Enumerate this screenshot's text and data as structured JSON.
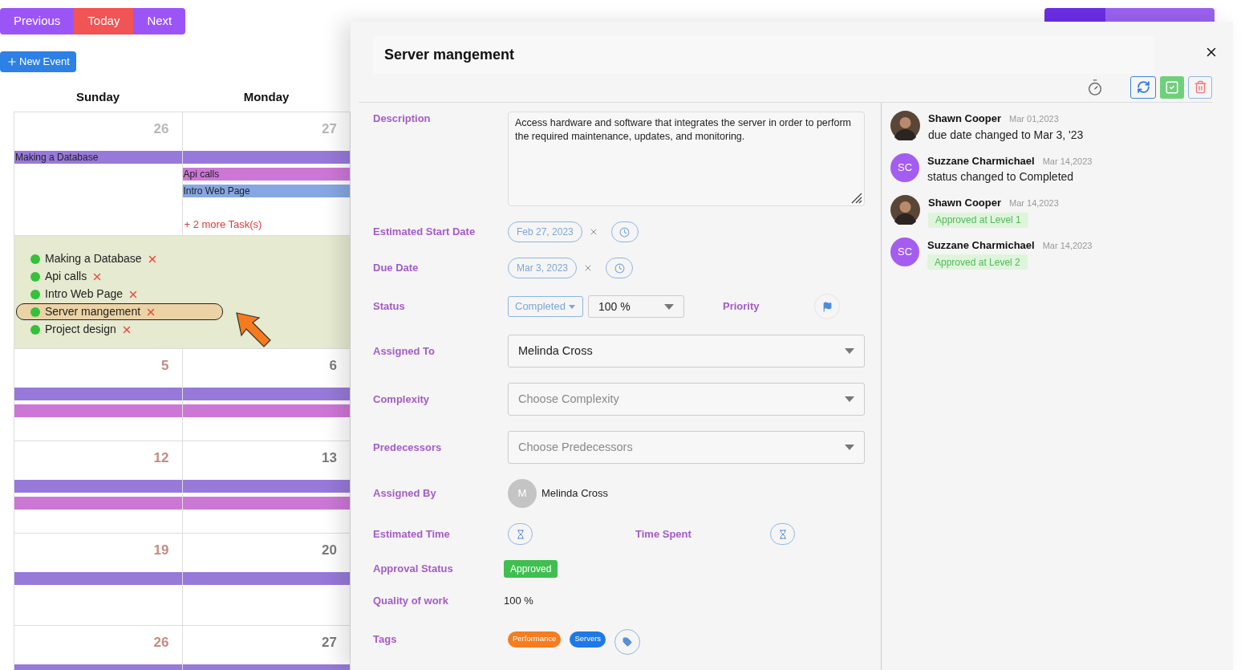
{
  "nav_buttons": [
    {
      "label": "Previous",
      "kind": "prev"
    },
    {
      "label": "Today",
      "kind": "today"
    },
    {
      "label": "Next",
      "kind": "next"
    }
  ],
  "new_event_button": {
    "label": "New Event"
  },
  "calendar": {
    "views": [
      {
        "selected": true
      },
      {
        "selected": false
      },
      {
        "selected": false
      }
    ],
    "weekdays": [
      "Sunday",
      "Monday"
    ],
    "weeks": [
      {
        "days": [
          {
            "date": "26",
            "kind": "other_month",
            "events": [
              {
                "label": "Making a Database",
                "color": "#9779d9"
              }
            ]
          },
          {
            "date": "27",
            "kind": "other_month",
            "events": [
              {
                "color": "#9779d9"
              },
              {
                "label": "Api calls",
                "color": "#cc77d6"
              },
              {
                "label": "Intro Web Page",
                "color": "#86a7e3"
              }
            ],
            "more": "+ 2 more Task(s)"
          }
        ],
        "popover": {
          "tasks": [
            {
              "label": "Making a Database",
              "selected": false
            },
            {
              "label": "Api calls",
              "selected": false
            },
            {
              "label": "Intro Web Page",
              "selected": false
            },
            {
              "label": "Server mangement",
              "selected": true
            },
            {
              "label": "Project design",
              "selected": false
            }
          ]
        }
      },
      {
        "days": [
          {
            "date": "5",
            "kind": "weekend",
            "events": [
              {
                "color": "#9779d9"
              },
              {
                "color": "#cc77d6"
              }
            ]
          },
          {
            "date": "6",
            "kind": "weekday",
            "events": [
              {
                "color": "#9779d9"
              },
              {
                "color": "#cc77d6"
              }
            ]
          }
        ]
      },
      {
        "days": [
          {
            "date": "12",
            "kind": "weekend",
            "events": [
              {
                "color": "#9779d9"
              },
              {
                "color": "#cc77d6"
              }
            ]
          },
          {
            "date": "13",
            "kind": "weekday",
            "events": [
              {
                "color": "#9779d9"
              },
              {
                "color": "#cc77d6"
              }
            ]
          }
        ]
      },
      {
        "days": [
          {
            "date": "19",
            "kind": "weekend",
            "events": [
              {
                "color": "#9779d9"
              }
            ]
          },
          {
            "date": "20",
            "kind": "weekday",
            "events": [
              {
                "color": "#9779d9"
              }
            ]
          }
        ]
      },
      {
        "days": [
          {
            "date": "26",
            "kind": "weekend",
            "events": [
              {
                "color": "#9779d9"
              }
            ]
          },
          {
            "date": "27",
            "kind": "weekday",
            "events": [
              {
                "color": "#9779d9"
              }
            ]
          }
        ]
      }
    ]
  },
  "panel": {
    "title": "Server mangement",
    "fields": [
      {
        "label": "Description",
        "kind": "textarea",
        "value": "Access hardware and software that integrates the server in order to perform the required maintenance, updates, and monitoring."
      },
      {
        "label": "Estimated Start Date",
        "kind": "date",
        "value": "Feb 27, 2023"
      },
      {
        "label": "Due Date",
        "kind": "date",
        "value": "Mar 3, 2023"
      },
      {
        "label": "Status",
        "kind": "status",
        "status": "Completed",
        "progress": "100 %",
        "secondary_label": "Priority"
      },
      {
        "label": "Assigned To",
        "kind": "select",
        "value": "Melinda Cross"
      },
      {
        "label": "Complexity",
        "kind": "select",
        "placeholder": "Choose Complexity"
      },
      {
        "label": "Predecessors",
        "kind": "select",
        "placeholder": "Choose Predecessors"
      },
      {
        "label": "Assigned By",
        "kind": "user",
        "initial": "M",
        "value": "Melinda Cross"
      },
      {
        "label": "Estimated Time",
        "kind": "timers",
        "secondary_label": "Time Spent"
      },
      {
        "label": "Approval Status",
        "kind": "badge",
        "value": "Approved"
      },
      {
        "label": "Quality of work",
        "kind": "text",
        "value": "100 %"
      },
      {
        "label": "Tags",
        "kind": "tags",
        "tags": [
          {
            "label": "Performance",
            "color": "#f57c1f"
          },
          {
            "label": "Servers",
            "color": "#1e78e6"
          }
        ]
      }
    ],
    "activity": [
      {
        "name": "Shawn Cooper",
        "date": "Mar 01,2023",
        "kind": "change",
        "text": "due date changed to Mar 3, '23"
      },
      {
        "name": "Suzzane Charmichael",
        "date": "Mar 14,2023",
        "initials": "SC",
        "kind": "change",
        "text": "status changed to Completed"
      },
      {
        "name": "Shawn Cooper",
        "date": "Mar 14,2023",
        "kind": "approval",
        "text": "Approved at Level 1"
      },
      {
        "name": "Suzzane Charmichael",
        "date": "Mar 14,2023",
        "initials": "SC",
        "kind": "approval",
        "text": "Approved at Level 2"
      }
    ]
  }
}
